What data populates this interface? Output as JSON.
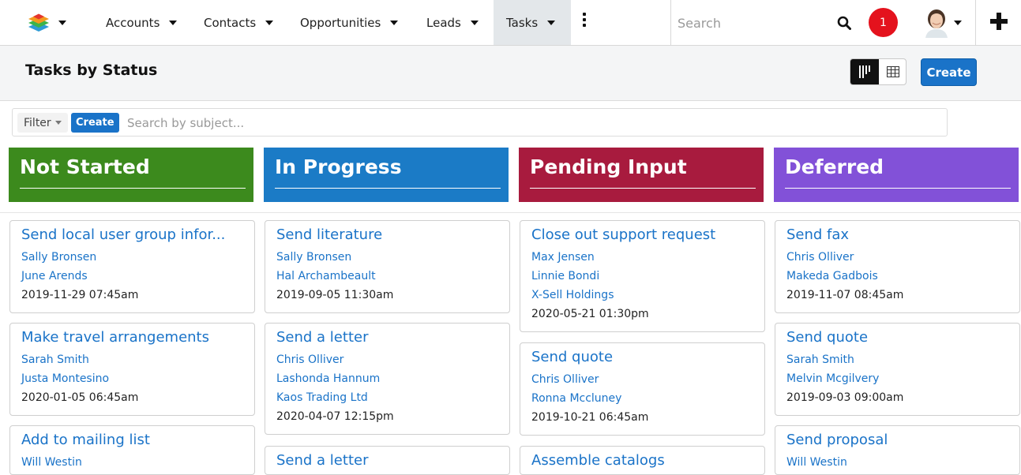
{
  "nav": {
    "items": [
      {
        "label": "Accounts"
      },
      {
        "label": "Contacts"
      },
      {
        "label": "Opportunities"
      },
      {
        "label": "Leads"
      },
      {
        "label": "Tasks"
      }
    ],
    "search_placeholder": "Search",
    "notification_count": "1"
  },
  "header": {
    "title": "Tasks by Status",
    "create_label": "Create"
  },
  "filter": {
    "filter_label": "Filter",
    "create_label": "Create",
    "search_placeholder": "Search by subject..."
  },
  "columns": [
    {
      "title": "Not Started",
      "color": "#3c8a1d",
      "cards": [
        {
          "subject": "Send local user group infor...",
          "links": [
            "Sally Bronsen",
            "June Arends"
          ],
          "date": "2019-11-29 07:45am"
        },
        {
          "subject": "Make travel arrangements",
          "links": [
            "Sarah Smith",
            "Justa Montesino"
          ],
          "date": "2020-01-05 06:45am"
        },
        {
          "subject": "Add to mailing list",
          "links": [
            "Will Westin"
          ],
          "date": ""
        }
      ]
    },
    {
      "title": "In Progress",
      "color": "#1b7bc6",
      "cards": [
        {
          "subject": "Send literature",
          "links": [
            "Sally Bronsen",
            "Hal Archambeault"
          ],
          "date": "2019-09-05 11:30am"
        },
        {
          "subject": "Send a letter",
          "links": [
            "Chris Olliver",
            "Lashonda Hannum",
            "Kaos Trading Ltd"
          ],
          "date": "2020-04-07 12:15pm"
        },
        {
          "subject": "Send a letter",
          "links": [],
          "date": ""
        }
      ]
    },
    {
      "title": "Pending Input",
      "color": "#a81b3e",
      "cards": [
        {
          "subject": "Close out support request",
          "links": [
            "Max Jensen",
            "Linnie Bondi",
            "X-Sell Holdings"
          ],
          "date": "2020-05-21 01:30pm"
        },
        {
          "subject": "Send quote",
          "links": [
            "Chris Olliver",
            "Ronna Mccluney"
          ],
          "date": "2019-10-21 06:45am"
        },
        {
          "subject": "Assemble catalogs",
          "links": [],
          "date": ""
        }
      ]
    },
    {
      "title": "Deferred",
      "color": "#8251d8",
      "cards": [
        {
          "subject": "Send fax",
          "links": [
            "Chris Olliver",
            "Makeda Gadbois"
          ],
          "date": "2019-11-07 08:45am"
        },
        {
          "subject": "Send quote",
          "links": [
            "Sarah Smith",
            "Melvin Mcgilvery"
          ],
          "date": "2019-09-03 09:00am"
        },
        {
          "subject": "Send proposal",
          "links": [
            "Will Westin"
          ],
          "date": ""
        }
      ]
    }
  ]
}
